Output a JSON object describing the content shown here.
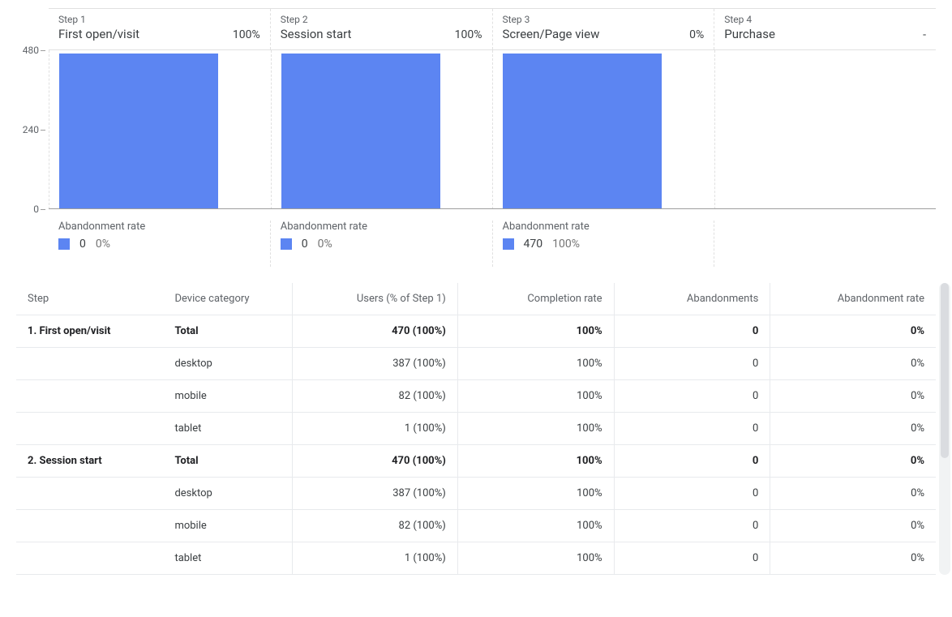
{
  "chart_data": {
    "type": "bar",
    "title": "",
    "xlabel": "",
    "ylabel": "",
    "ylim": [
      0,
      480
    ],
    "y_ticks": [
      0,
      240,
      480
    ],
    "categories": [
      "First open/visit",
      "Session start",
      "Screen/Page view",
      "Purchase"
    ],
    "values": [
      470,
      470,
      470,
      0
    ],
    "bar_color": "#5c85f2"
  },
  "funnel": {
    "steps": [
      {
        "index_label": "Step 1",
        "title": "First open/visit",
        "pct": "100%",
        "abandonment": {
          "label": "Abandonment rate",
          "count": "0",
          "pct": "0%"
        }
      },
      {
        "index_label": "Step 2",
        "title": "Session start",
        "pct": "100%",
        "abandonment": {
          "label": "Abandonment rate",
          "count": "0",
          "pct": "0%"
        }
      },
      {
        "index_label": "Step 3",
        "title": "Screen/Page view",
        "pct": "0%",
        "abandonment": {
          "label": "Abandonment rate",
          "count": "470",
          "pct": "100%"
        }
      },
      {
        "index_label": "Step 4",
        "title": "Purchase",
        "pct": "-",
        "abandonment": null
      }
    ]
  },
  "table": {
    "headers": {
      "step": "Step",
      "device": "Device category",
      "users": "Users (% of Step 1)",
      "completion": "Completion rate",
      "abandonments": "Abandonments",
      "abandon_rate": "Abandonment rate"
    },
    "groups": [
      {
        "step_label": "1. First open/visit",
        "total": {
          "device": "Total",
          "users": "470 (100%)",
          "completion": "100%",
          "abandonments": "0",
          "abandon_rate": "0%"
        },
        "rows": [
          {
            "device": "desktop",
            "users": "387 (100%)",
            "completion": "100%",
            "abandonments": "0",
            "abandon_rate": "0%"
          },
          {
            "device": "mobile",
            "users": "82 (100%)",
            "completion": "100%",
            "abandonments": "0",
            "abandon_rate": "0%"
          },
          {
            "device": "tablet",
            "users": "1 (100%)",
            "completion": "100%",
            "abandonments": "0",
            "abandon_rate": "0%"
          }
        ]
      },
      {
        "step_label": "2. Session start",
        "total": {
          "device": "Total",
          "users": "470 (100%)",
          "completion": "100%",
          "abandonments": "0",
          "abandon_rate": "0%"
        },
        "rows": [
          {
            "device": "desktop",
            "users": "387 (100%)",
            "completion": "100%",
            "abandonments": "0",
            "abandon_rate": "0%"
          },
          {
            "device": "mobile",
            "users": "82 (100%)",
            "completion": "100%",
            "abandonments": "0",
            "abandon_rate": "0%"
          },
          {
            "device": "tablet",
            "users": "1 (100%)",
            "completion": "100%",
            "abandonments": "0",
            "abandon_rate": "0%"
          }
        ]
      }
    ]
  },
  "scrollbar": {
    "thumb_top_pct": 0,
    "thumb_height_pct": 60
  }
}
